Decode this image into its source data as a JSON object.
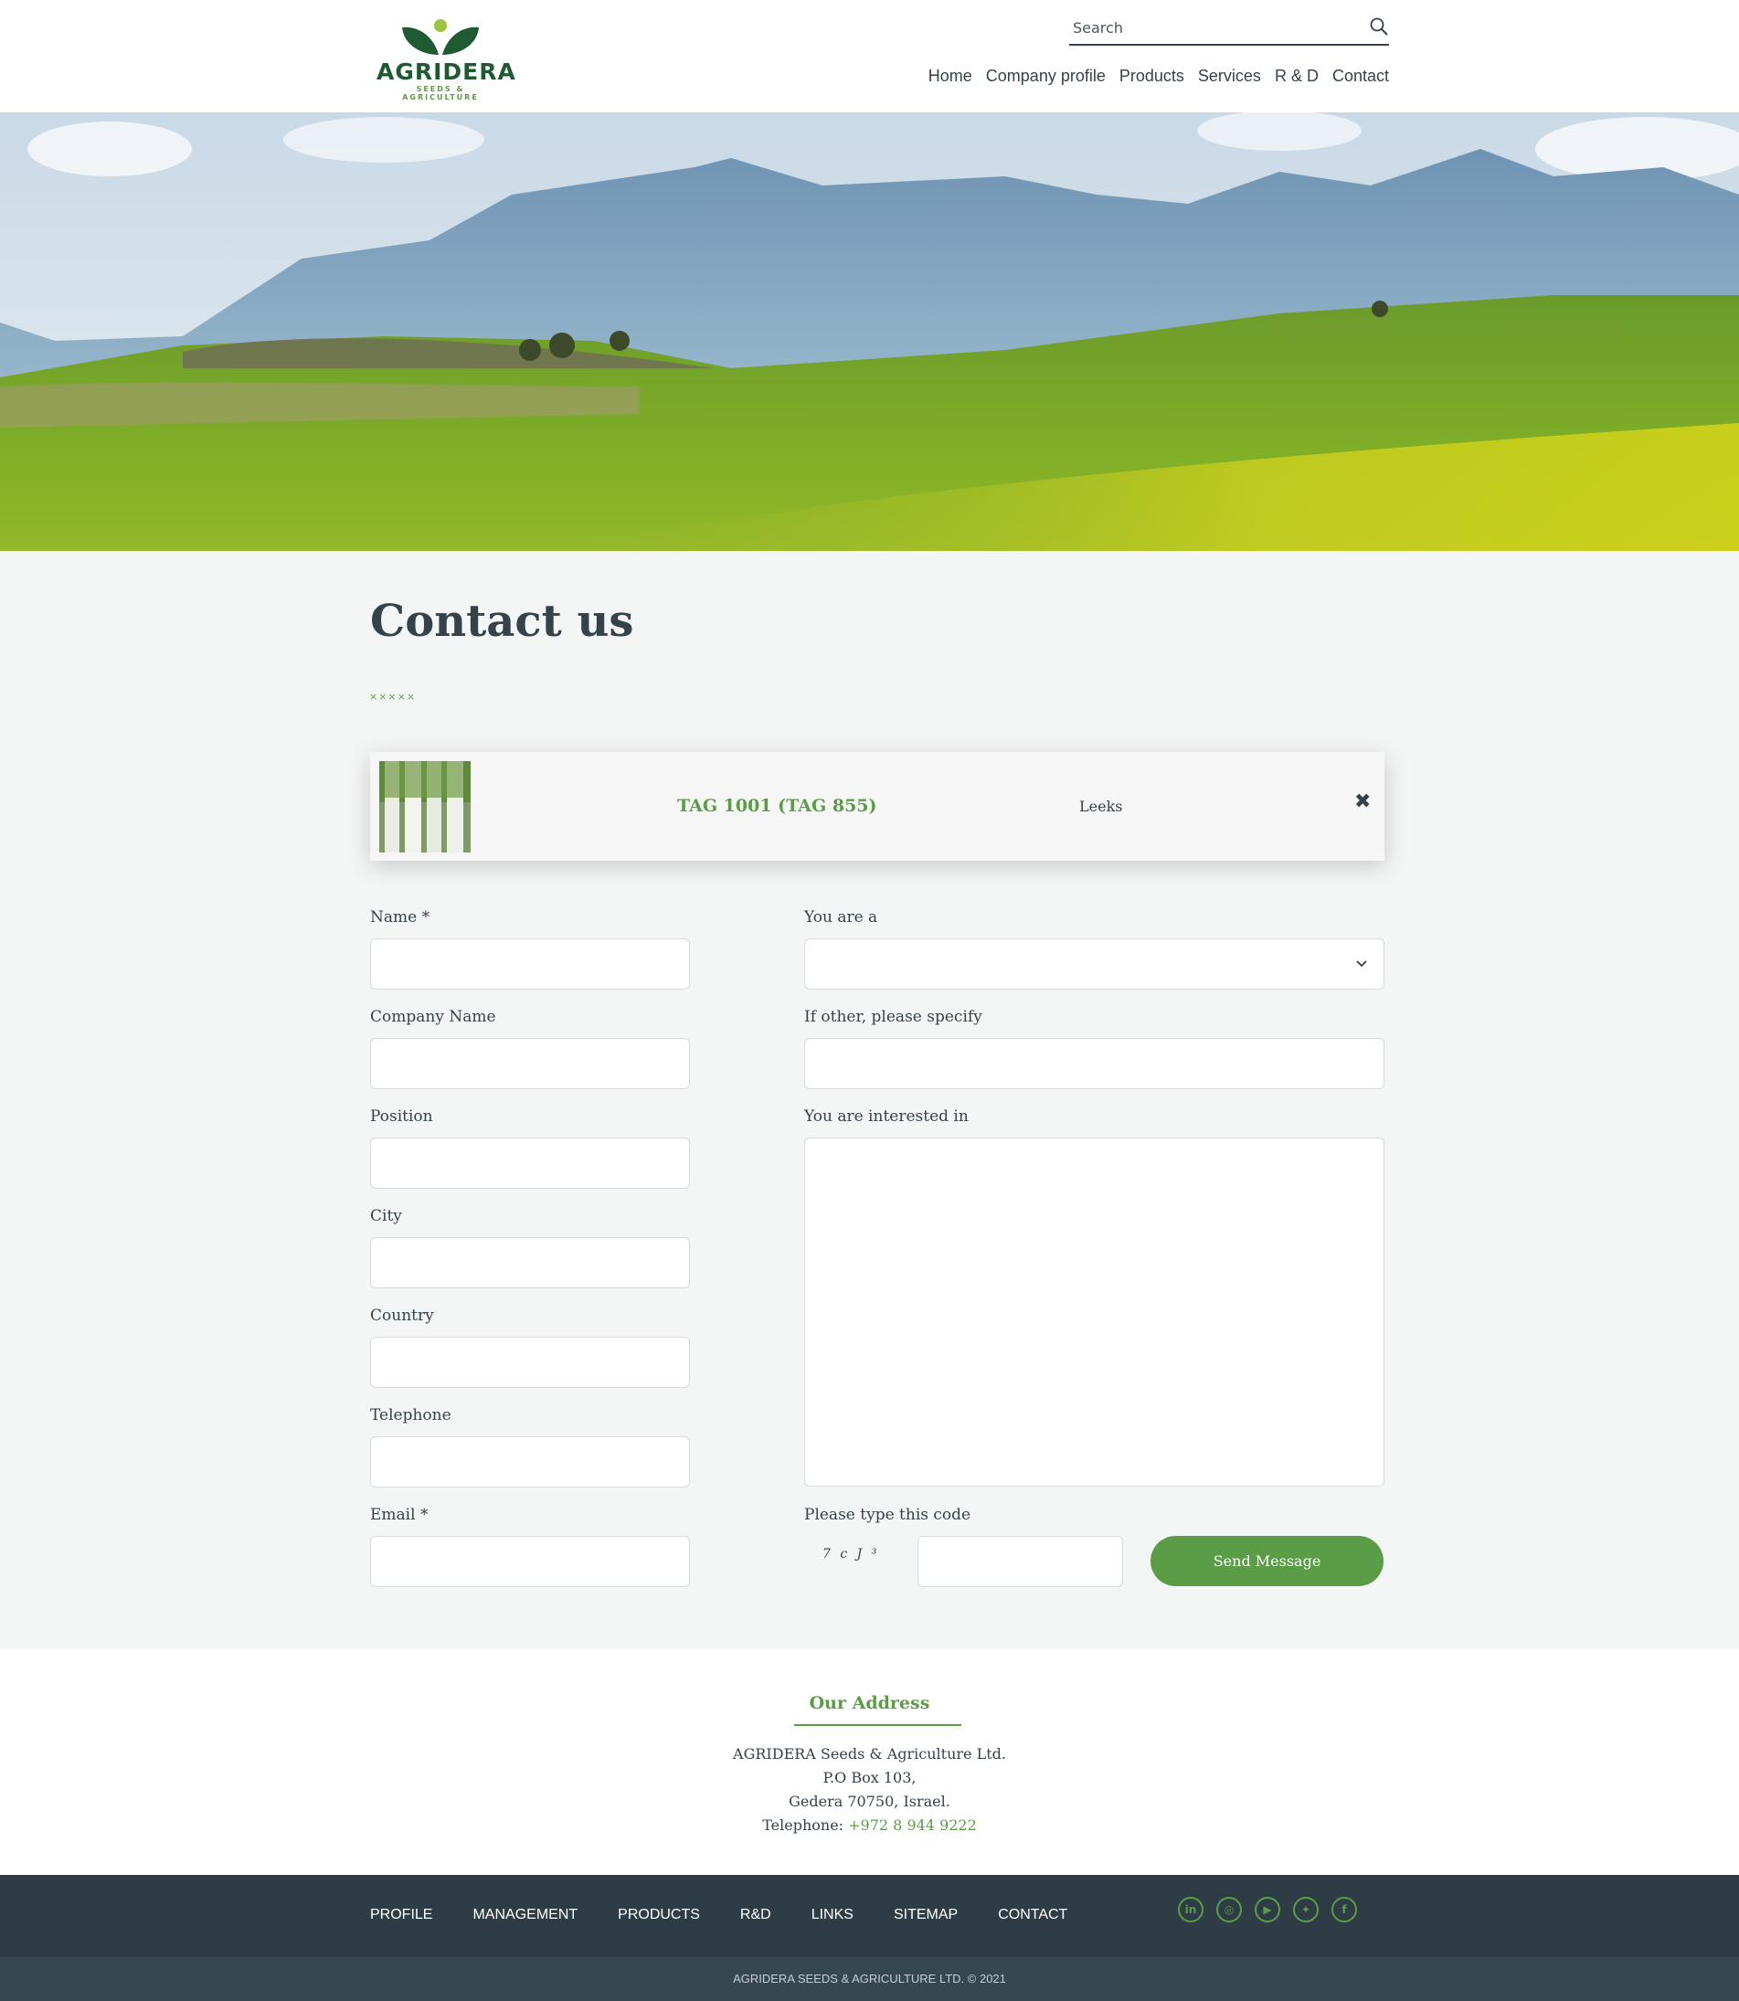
{
  "header": {
    "logo_word": "AGRIDERA",
    "logo_tagline": "SEEDS & AGRICULTURE",
    "search_placeholder": "Search",
    "nav": [
      "Home",
      "Company profile",
      "Products",
      "Services",
      "R & D",
      "Contact"
    ]
  },
  "page": {
    "title": "Contact us",
    "stars": "×××××"
  },
  "product": {
    "name": "TAG 1001 (TAG 855)",
    "category": "Leeks",
    "close": "✖"
  },
  "form": {
    "left": {
      "name_label": "Name *",
      "company_label": "Company Name",
      "position_label": "Position",
      "city_label": "City",
      "country_label": "Country",
      "telephone_label": "Telephone",
      "email_label": "Email *"
    },
    "right": {
      "you_are_label": "You are a",
      "other_label": "If other, please specify",
      "interested_label": "You are interested in",
      "code_label": "Please type this code",
      "captcha_text": "7 c J ³",
      "send_label": "Send Message"
    }
  },
  "address": {
    "title": "Our Address",
    "line1": "AGRIDERA Seeds & Agriculture Ltd.",
    "line2": "P.O Box 103,",
    "line3": "Gedera 70750, Israel.",
    "phone_prefix": "Telephone: ",
    "phone": "+972 8 944 9222"
  },
  "footer": {
    "links": [
      "PROFILE",
      "MANAGEMENT",
      "PRODUCTS",
      "R&D",
      "LINKS",
      "SITEMAP",
      "CONTACT"
    ],
    "social": [
      "linkedin-icon",
      "instagram-icon",
      "youtube-icon",
      "twitter-icon",
      "facebook-icon"
    ],
    "copyright": "AGRIDERA SEEDS & AGRICULTURE LTD. © 2021"
  },
  "colors": {
    "accent": "#5b9c46",
    "dark": "#35424a",
    "footer": "#2e3d45"
  }
}
